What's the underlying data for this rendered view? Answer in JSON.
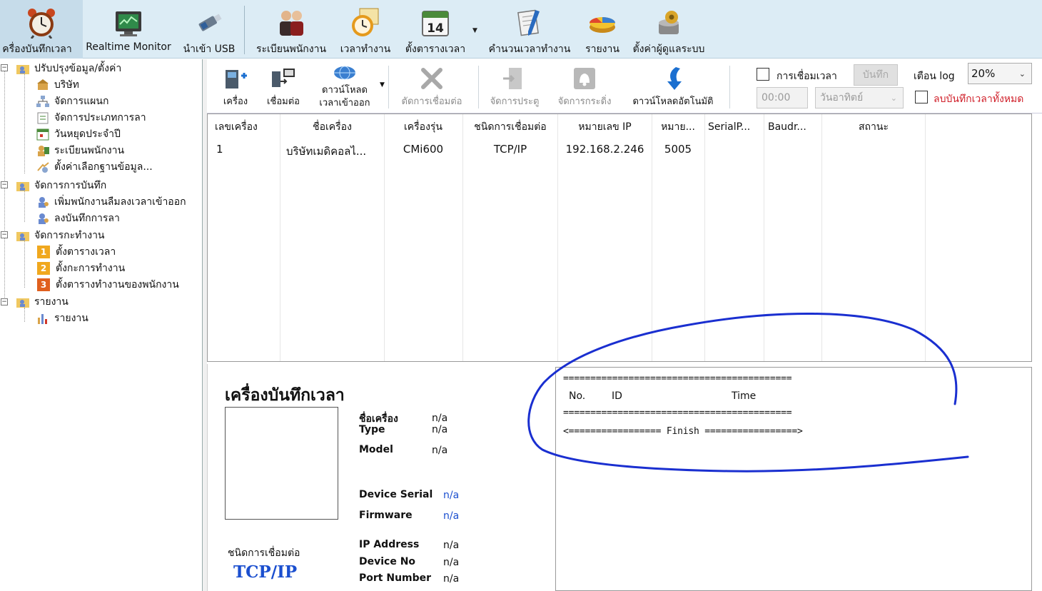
{
  "ribbon": {
    "items": [
      {
        "label": "ครื่องบันทึกเวลา",
        "icon": "alarm-clock-icon"
      },
      {
        "label": "Realtime Monitor",
        "icon": "monitor-icon"
      },
      {
        "label": "นำเข้า USB",
        "icon": "usb-drive-icon"
      },
      {
        "label": "ระเบียนพนักงาน",
        "icon": "employees-icon"
      },
      {
        "label": "เวลาทำงาน",
        "icon": "work-time-clock-icon"
      },
      {
        "label": "ตั้งตารางเวลา",
        "icon": "calendar-14-icon"
      },
      {
        "label": "คำนวนเวลาทำงาน",
        "icon": "calculate-document-icon"
      },
      {
        "label": "รายงาน",
        "icon": "pie-chart-icon"
      },
      {
        "label": "ตั้งค่าผู้ดูแลระบบ",
        "icon": "admin-settings-icon"
      }
    ],
    "calendar_day": "14"
  },
  "tree": {
    "groups": [
      {
        "label": "ปรับปรุงข้อมูล/ตั้งค่า",
        "children": [
          "บริษัท",
          "จัดการแผนก",
          "จัดการประเภทการลา",
          "วันหยุดประจำปี",
          "ระเบียนพนักงาน",
          "ตั้งค่าเลือกฐานข้อมูล..."
        ]
      },
      {
        "label": "จัดการการบันทึก",
        "children": [
          "เพิ่มพนักงานลืมลงเวลาเข้าออก",
          "ลงบันทึกการลา"
        ]
      },
      {
        "label": "จัดการกะทำงาน",
        "children": [
          "ตั้งตารางเวลา",
          "ตั้งกะการทำงาน",
          "ตั้งตารางทำงานของพนักงาน"
        ],
        "numbers": [
          "1",
          "2",
          "3"
        ]
      },
      {
        "label": "รายงาน",
        "children": [
          "รายงาน"
        ]
      }
    ]
  },
  "toolbar": {
    "machine": "เครื่อง",
    "connect": "เชื่อมต่อ",
    "download_line1": "ดาวน์โหลด",
    "download_line2": "เวลาเข้าออก",
    "disconnect": "ตัดการเชื่อมต่อ",
    "door": "จัดการประตู",
    "bell": "จัดการกระดิ่ง",
    "auto_download": "ดาวน์โหลดอัตโนมัติ",
    "sync_time_label": "การเชื่อมเวลา",
    "save_label": "บันทึก",
    "time_value": "00:00",
    "day_value": "วันอาทิตย์",
    "log_warn_label": "เตือน log",
    "log_percent": "20%",
    "delete_all_label": "ลบบันทึกเวลาทั้งหมด"
  },
  "grid": {
    "headers": [
      "เลขเครื่อง",
      "ชื่อเครื่อง",
      "เครื่องรุ่น",
      "ชนิดการเชื่อมต่อ",
      "หมายเลข IP",
      "หมาย...",
      "SerialP...",
      "Baudr...",
      "สถานะ"
    ],
    "rows": [
      [
        "1",
        "บริษัทเมดิคอลไ...",
        "CMi600",
        "TCP/IP",
        "192.168.2.246",
        "5005",
        "",
        "",
        ""
      ]
    ]
  },
  "device_info": {
    "title": "เครื่องบันทึกเวลา",
    "name_label": "ชื่อเครื่อง",
    "name_value": "n/a",
    "type_label": "Type",
    "type_value": "n/a",
    "model_label": "Model",
    "model_value": "n/a",
    "serial_label": "Device Serial",
    "serial_value": "n/a",
    "firmware_label": "Firmware",
    "firmware_value": "n/a",
    "conn_type_label": "ชนิดการเชื่อมต่อ",
    "conn_type_value": "TCP/IP",
    "ip_label": "IP Address",
    "ip_value": "n/a",
    "devno_label": "Device No",
    "devno_value": "n/a",
    "port_label": "Port Number",
    "port_value": "n/a"
  },
  "log": {
    "separator": "==========================================",
    "col_no": "No.",
    "col_id": "ID",
    "col_time": "Time",
    "finish_line": "<================= Finish =================>"
  },
  "colors": {
    "ribbon_bg": "#dcecf5",
    "annotation_ink": "#1a2fd0",
    "link_blue": "#1b4fcf",
    "delete_red": "#d0202a"
  }
}
